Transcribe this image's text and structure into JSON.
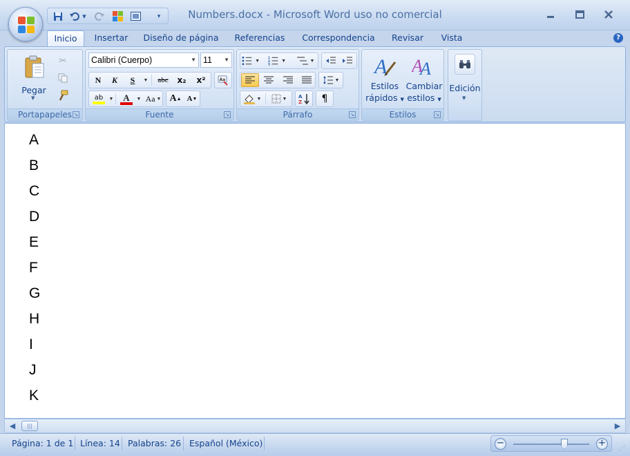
{
  "window": {
    "title": "Numbers.docx - Microsoft Word uso no comercial",
    "minimize_icon": "minimize-icon",
    "maximize_icon": "maximize-icon",
    "close_icon": "close-icon"
  },
  "quick_access": {
    "items": [
      "save-icon",
      "undo-icon",
      "redo-icon",
      "layout-icon",
      "view-icon",
      "customize-icon"
    ]
  },
  "tabs": [
    {
      "label": "Inicio",
      "active": true
    },
    {
      "label": "Insertar",
      "active": false
    },
    {
      "label": "Diseño de página",
      "active": false
    },
    {
      "label": "Referencias",
      "active": false
    },
    {
      "label": "Correspondencia",
      "active": false
    },
    {
      "label": "Revisar",
      "active": false
    },
    {
      "label": "Vista",
      "active": false
    }
  ],
  "ribbon": {
    "clipboard": {
      "label": "Portapapeles",
      "paste_label": "Pegar"
    },
    "font": {
      "label": "Fuente",
      "font_name": "Calibri (Cuerpo)",
      "font_size": "11",
      "bold": "N",
      "italic": "K",
      "underline": "S",
      "strike": "abc",
      "subscript": "x₂",
      "superscript": "x²",
      "change_case": "Aa",
      "grow": "A",
      "shrink": "A",
      "highlight_color": "#ffff00",
      "font_color": "#e00000"
    },
    "paragraph": {
      "label": "Párrafo"
    },
    "styles": {
      "label": "Estilos",
      "quick_styles_line1": "Estilos",
      "quick_styles_line2": "rápidos",
      "change_styles_line1": "Cambiar",
      "change_styles_line2": "estilos"
    },
    "editing": {
      "label": "Edición"
    }
  },
  "document": {
    "lines": [
      "A",
      "B",
      "C",
      "D",
      "E",
      "F",
      "G",
      "H",
      "I",
      "J",
      "K"
    ]
  },
  "status": {
    "page": "Página: 1 de 1",
    "line": "Línea: 14",
    "words": "Palabras: 26",
    "language": "Español (México)"
  },
  "zoom": {
    "minus": "−",
    "plus": "+",
    "level_fraction": 0.66
  }
}
